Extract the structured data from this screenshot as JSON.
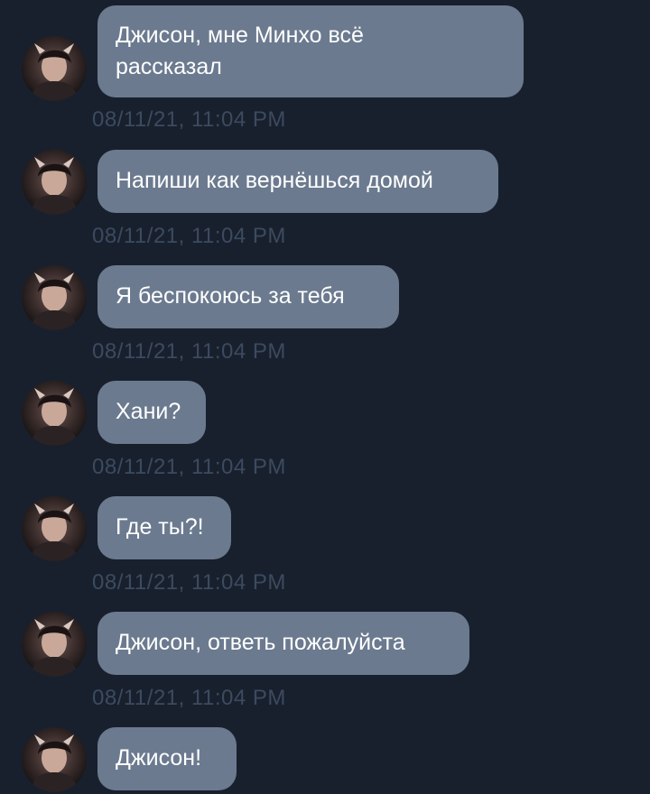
{
  "messages": [
    {
      "text": "Джисон, мне Минхо всё рассказал",
      "lines": [
        "Джисон, мне Минхо всё",
        "рассказал"
      ],
      "time": "08/11/21, 11:04 PM"
    },
    {
      "text": "Напиши как вернёшься домой",
      "lines": [
        "Напиши как вернёшься домой"
      ],
      "time": "08/11/21, 11:04 PM"
    },
    {
      "text": "Я беспокоюсь за тебя",
      "lines": [
        "Я беспокоюсь за тебя"
      ],
      "time": "08/11/21, 11:04 PM"
    },
    {
      "text": "Хани?",
      "lines": [
        "Хани?"
      ],
      "time": "08/11/21, 11:04 PM"
    },
    {
      "text": "Где ты?!",
      "lines": [
        "Где ты?!"
      ],
      "time": "08/11/21, 11:04 PM"
    },
    {
      "text": "Джисон, ответь пожалуйста",
      "lines": [
        "Джисон, ответь пожалуйста"
      ],
      "time": "08/11/21, 11:04 PM"
    },
    {
      "text": "Джисон!",
      "lines": [
        "Джисон!"
      ],
      "time": ""
    }
  ],
  "colors": {
    "background": "#18202d",
    "bubble": "#6b7a8f",
    "timestamp": "#3c4a5f",
    "text": "#ffffff"
  },
  "icons": {
    "avatar": "contact-avatar-photo"
  }
}
